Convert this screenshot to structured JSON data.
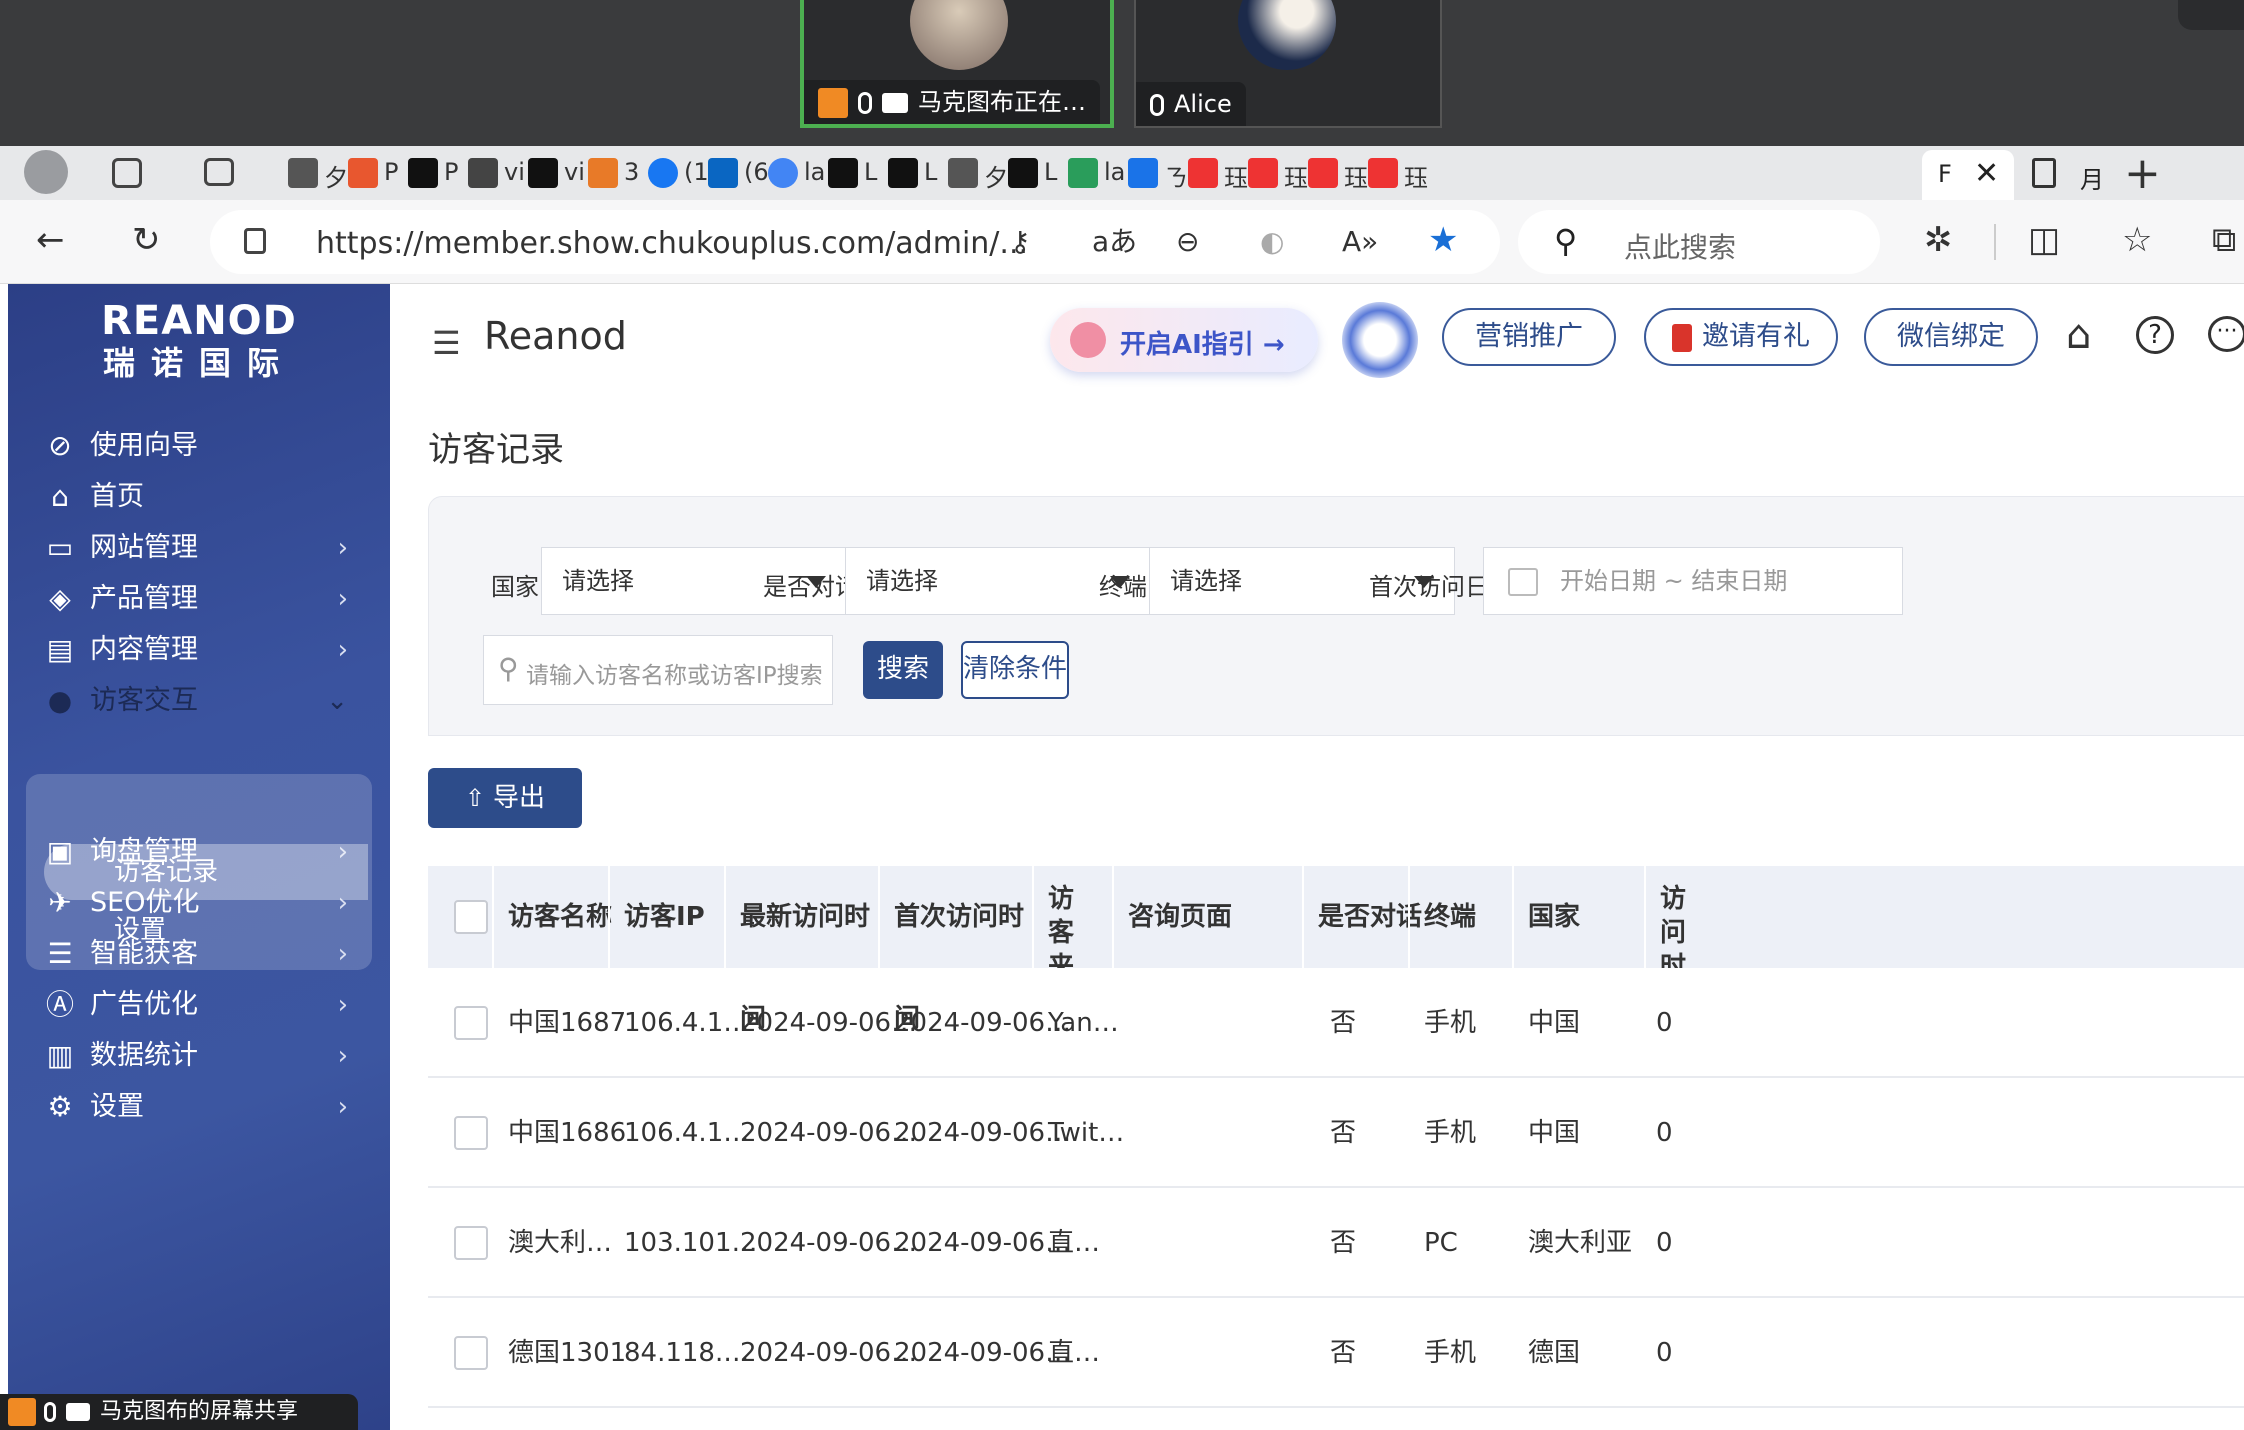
{
  "meeting": {
    "tile1_label": "马克图布正在…",
    "tile2_label": "Alice",
    "share_banner": "马克图布的屏幕共享"
  },
  "browser": {
    "tabs": [
      "夕",
      "P",
      "P",
      "vi",
      "vi",
      "3",
      "(1",
      "(6",
      "la",
      "L",
      "L",
      "夕",
      "L",
      "la",
      "ㄋ",
      "珏",
      "珏",
      "珏",
      "珏",
      "F",
      "月"
    ],
    "url": "https://member.show.chukouplus.com/admin/...",
    "search_placeholder": "点此搜索"
  },
  "sidebar": {
    "logo_en": "REANOD",
    "logo_cn": "瑞诺国际",
    "items": [
      {
        "label": "使用向导",
        "icon": "compass-icon"
      },
      {
        "label": "首页",
        "icon": "home-icon"
      },
      {
        "label": "网站管理",
        "icon": "monitor-icon"
      },
      {
        "label": "产品管理",
        "icon": "box-icon"
      },
      {
        "label": "内容管理",
        "icon": "document-icon"
      },
      {
        "label": "访客交互",
        "icon": "user-icon"
      },
      {
        "label": "询盘管理",
        "icon": "inquiry-icon"
      },
      {
        "label": "SEO优化",
        "icon": "rocket-icon"
      },
      {
        "label": "智能获客",
        "icon": "list-icon"
      },
      {
        "label": "广告优化",
        "icon": "ad-icon"
      },
      {
        "label": "数据统计",
        "icon": "chart-icon"
      },
      {
        "label": "设置",
        "icon": "settings-icon"
      }
    ],
    "submenu": [
      "访客记录",
      "设置"
    ]
  },
  "header": {
    "brand": "Reanod",
    "ai_guide": "开启AI指引 →",
    "marketing": "营销推广",
    "invite": "邀请有礼",
    "wechat": "微信绑定"
  },
  "page": {
    "title": "访客记录"
  },
  "filters": {
    "country_label": "国家",
    "dialog_label": "是否对话",
    "terminal_label": "终端",
    "first_visit_label": "首次访问日期",
    "select_placeholder": "请选择",
    "date_placeholder": "开始日期 ~ 结束日期",
    "search_placeholder": "请输入访客名称或访客IP搜索",
    "search_btn": "搜索",
    "clear_btn": "清除条件"
  },
  "table": {
    "export_btn": "导出",
    "columns": [
      "访客名称",
      "访客IP",
      "最新访问时间",
      "首次访问时间",
      "访客来源",
      "咨询页面",
      "是否对话",
      "终端",
      "国家",
      "访问时长"
    ],
    "rows": [
      {
        "name": "中国1687",
        "ip": "106.4.1…",
        "latest": "2024-09-06…",
        "first": "2024-09-06…",
        "source": "Yan…",
        "page": "",
        "dialog": "否",
        "terminal": "手机",
        "country": "中国",
        "extra": "0"
      },
      {
        "name": "中国1686",
        "ip": "106.4.1…",
        "latest": "2024-09-06…",
        "first": "2024-09-06…",
        "source": "Twit…",
        "page": "",
        "dialog": "否",
        "terminal": "手机",
        "country": "中国",
        "extra": "0"
      },
      {
        "name": "澳大利…",
        "ip": "103.101…",
        "latest": "2024-09-06…",
        "first": "2024-09-06…",
        "source": "直…",
        "page": "",
        "dialog": "否",
        "terminal": "PC",
        "country": "澳大利亚",
        "extra": "0"
      },
      {
        "name": "德国1301",
        "ip": "84.118.…",
        "latest": "2024-09-06…",
        "first": "2024-09-06…",
        "source": "直…",
        "page": "",
        "dialog": "否",
        "terminal": "手机",
        "country": "德国",
        "extra": "0"
      }
    ]
  },
  "colors": {
    "sidebar": "#3a539f",
    "primary": "#2d4c8a",
    "table_header": "#edf0f7"
  }
}
